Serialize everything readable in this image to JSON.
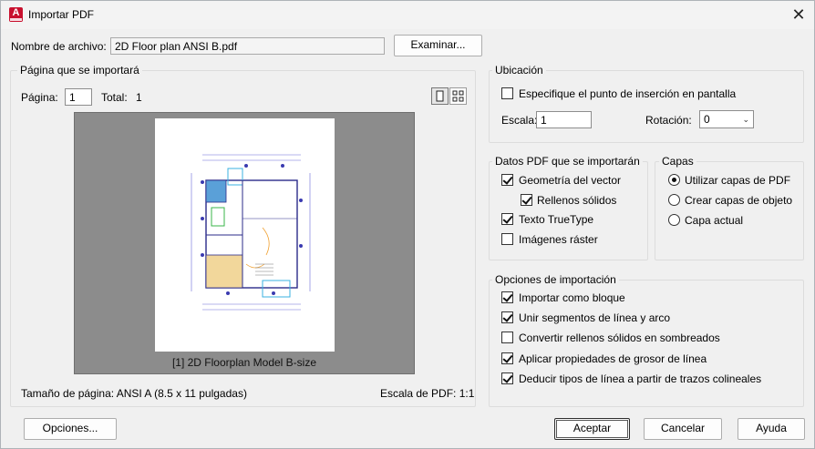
{
  "window": {
    "title": "Importar PDF",
    "close": "✕"
  },
  "file": {
    "label": "Nombre de archivo:",
    "value": "2D Floor plan ANSI B.pdf",
    "browse": "Examinar..."
  },
  "page_group": {
    "title": "Página que se importará",
    "page_label": "Página:",
    "page_value": "1",
    "total_label": "Total:",
    "total_value": "1",
    "preview_caption": "[1] 2D Floorplan Model B-size",
    "size_label": "Tamaño de página:",
    "size_value": "ANSI A (8.5 x 11 pulgadas)",
    "scale_label": "Escala de PDF:",
    "scale_value": "1:1"
  },
  "location": {
    "title": "Ubicación",
    "specify_onscreen": "Especifique el punto de inserción en pantalla",
    "specify_checked": false,
    "scale_label": "Escala:",
    "scale_value": "1",
    "rotation_label": "Rotación:",
    "rotation_value": "0"
  },
  "pdf_data": {
    "title": "Datos PDF que se importarán",
    "items": [
      {
        "label": "Geometría del vector",
        "checked": true
      },
      {
        "label": "Rellenos sólidos",
        "checked": true
      },
      {
        "label": "Texto TrueType",
        "checked": true
      },
      {
        "label": "Imágenes ráster",
        "checked": false
      }
    ]
  },
  "layers": {
    "title": "Capas",
    "options": [
      {
        "label": "Utilizar capas de PDF",
        "selected": true
      },
      {
        "label": "Crear capas de objeto",
        "selected": false
      },
      {
        "label": "Capa actual",
        "selected": false
      }
    ]
  },
  "import_options": {
    "title": "Opciones de importación",
    "items": [
      {
        "label": "Importar como bloque",
        "checked": true
      },
      {
        "label": "Unir segmentos de línea y arco",
        "checked": true
      },
      {
        "label": "Convertir rellenos sólidos en sombreados",
        "checked": false
      },
      {
        "label": "Aplicar propiedades de grosor de línea",
        "checked": true
      },
      {
        "label": "Deducir tipos de línea a partir de trazos colineales",
        "checked": true
      }
    ]
  },
  "footer": {
    "options": "Opciones...",
    "accept": "Aceptar",
    "cancel": "Cancelar",
    "help": "Ayuda"
  },
  "icons": {
    "app": "autocad-app-icon",
    "close": "close-icon",
    "single_page": "single-page-view-icon",
    "grid": "thumbnail-grid-icon",
    "dropdown": "chevron-down-icon"
  },
  "colors": {
    "accent": "#c8102e",
    "preview_bg": "#8c8c8c",
    "plan_blue": "#5aa0d8",
    "plan_yellow": "#f2d79b",
    "plan_green": "#39b54a"
  }
}
